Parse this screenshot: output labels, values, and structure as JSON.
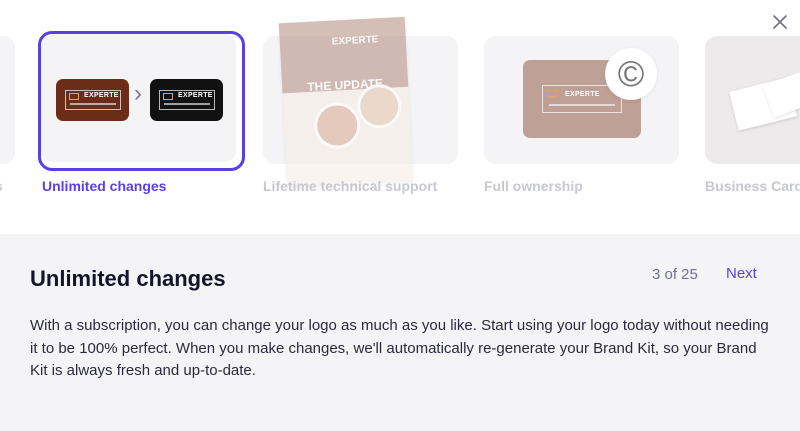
{
  "close_icon": "close-icon",
  "carousel": {
    "cards": [
      {
        "label": "s",
        "state": "previous-partial"
      },
      {
        "label": "Unlimited changes",
        "state": "selected"
      },
      {
        "label": "Lifetime technical support",
        "state": "inactive"
      },
      {
        "label": "Full ownership",
        "state": "inactive"
      },
      {
        "label": "Business Card",
        "state": "partial"
      }
    ],
    "preview": {
      "logo_text": "EXPERTE",
      "flyer_brand": "EXPERTE",
      "flyer_title": "THE UPDATE"
    }
  },
  "detail": {
    "title": "Unlimited changes",
    "counter": "3 of 25",
    "next_label": "Next",
    "description": "With a subscription, you can change your logo as much as you like. Start using your logo today without needing it to be 100% perfect. When you make changes, we'll automatically re-generate your Brand Kit, so your Brand Kit is always fresh and up-to-date."
  },
  "colors": {
    "accent": "#5b3ee6",
    "card_bg": "#f4f4f7",
    "brown_card": "#6b2d17",
    "dark_card": "#111111",
    "flyer_brown": "#b48a7a",
    "ownership_card": "#bfa096"
  }
}
